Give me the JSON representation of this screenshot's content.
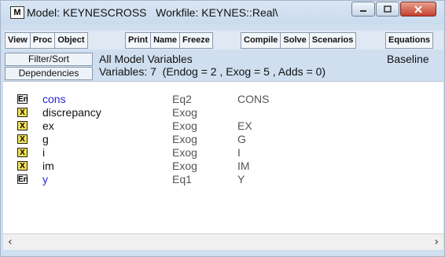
{
  "window": {
    "title": "Model: KEYNESCROSS   Workfile: KEYNES::Real\\"
  },
  "toolbar": {
    "groups": [
      [
        "View",
        "Proc",
        "Object"
      ],
      [
        "Print",
        "Name",
        "Freeze"
      ],
      [
        "Compile",
        "Solve",
        "Scenarios"
      ],
      [
        "Equations"
      ]
    ]
  },
  "header": {
    "filter_sort_label": "Filter/Sort",
    "dependencies_label": "Dependencies",
    "title": "All Model Variables",
    "scenario": "Baseline",
    "summary": "Variables: 7  (Endog = 2 , Exog = 5 , Adds = 0)"
  },
  "variables": [
    {
      "badge": "En",
      "name": "cons",
      "type": "Eq2",
      "equation": "CONS",
      "color": "#2626d8"
    },
    {
      "badge": "X",
      "name": "discrepancy",
      "type": "Exog",
      "equation": "",
      "color": "#111111"
    },
    {
      "badge": "X",
      "name": "ex",
      "type": "Exog",
      "equation": "EX",
      "color": "#111111"
    },
    {
      "badge": "X",
      "name": "g",
      "type": "Exog",
      "equation": "G",
      "color": "#111111"
    },
    {
      "badge": "X",
      "name": "i",
      "type": "Exog",
      "equation": "I",
      "color": "#111111"
    },
    {
      "badge": "X",
      "name": "im",
      "type": "Exog",
      "equation": "IM",
      "color": "#111111"
    },
    {
      "badge": "En",
      "name": "y",
      "type": "Eq1",
      "equation": "Y",
      "color": "#2626d8"
    }
  ],
  "scrollbar": {
    "left_icon": "chevron-left-icon",
    "right_icon": "chevron-right-icon",
    "left_glyph": "‹",
    "right_glyph": "›"
  },
  "colors": {
    "endogenous": "#2626d8",
    "exogenous_badge": "#f3e05a",
    "window_chrome": "#cfdff0",
    "close_button": "#c7402d"
  }
}
